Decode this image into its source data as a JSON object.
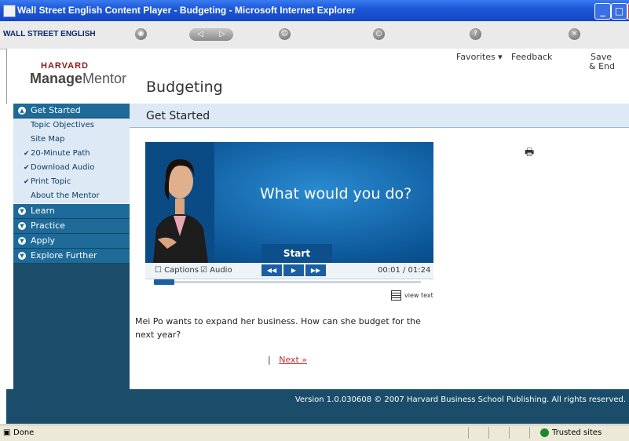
{
  "window": {
    "title": "Wall Street English Content Player - Budgeting - Microsoft Internet Explorer"
  },
  "toolbar": {
    "brand": "WALL STREET ENGLISH"
  },
  "header": {
    "logo_top": "HARVARD",
    "logo_main_1": "Manage",
    "logo_main_2": "Mentor",
    "title": "Budgeting",
    "links": {
      "favorites": "Favorites ▾",
      "feedback": "Feedback",
      "save": "Save",
      "save2": "& End"
    }
  },
  "sidebar": {
    "sections": [
      {
        "label": "Get Started"
      },
      {
        "label": "Learn"
      },
      {
        "label": "Practice"
      },
      {
        "label": "Apply"
      },
      {
        "label": "Explore Further"
      }
    ],
    "items": [
      {
        "label": "Topic Objectives",
        "check": ""
      },
      {
        "label": "Site Map",
        "check": ""
      },
      {
        "label": "20-Minute Path",
        "check": "✔"
      },
      {
        "label": "Download Audio",
        "check": "✔"
      },
      {
        "label": "Print Topic",
        "check": "✔"
      },
      {
        "label": "About the Mentor",
        "check": ""
      }
    ]
  },
  "main": {
    "heading": "Get Started",
    "video": {
      "question": "What would you do?",
      "start": "Start"
    },
    "controls": {
      "captions": "Captions",
      "audio": "Audio",
      "time": "00:01 / 01:24",
      "progress": 0.02
    },
    "view_text": "view text",
    "body": "Mei Po wants to expand her business. How can she budget for the next year?",
    "next_sep": "|",
    "next": "Next »"
  },
  "footer": {
    "text": "Version 1.0.030608 © 2007 Harvard Business School Publishing. All rights reserved."
  },
  "status": {
    "left": "Done",
    "zone": "Trusted sites"
  }
}
